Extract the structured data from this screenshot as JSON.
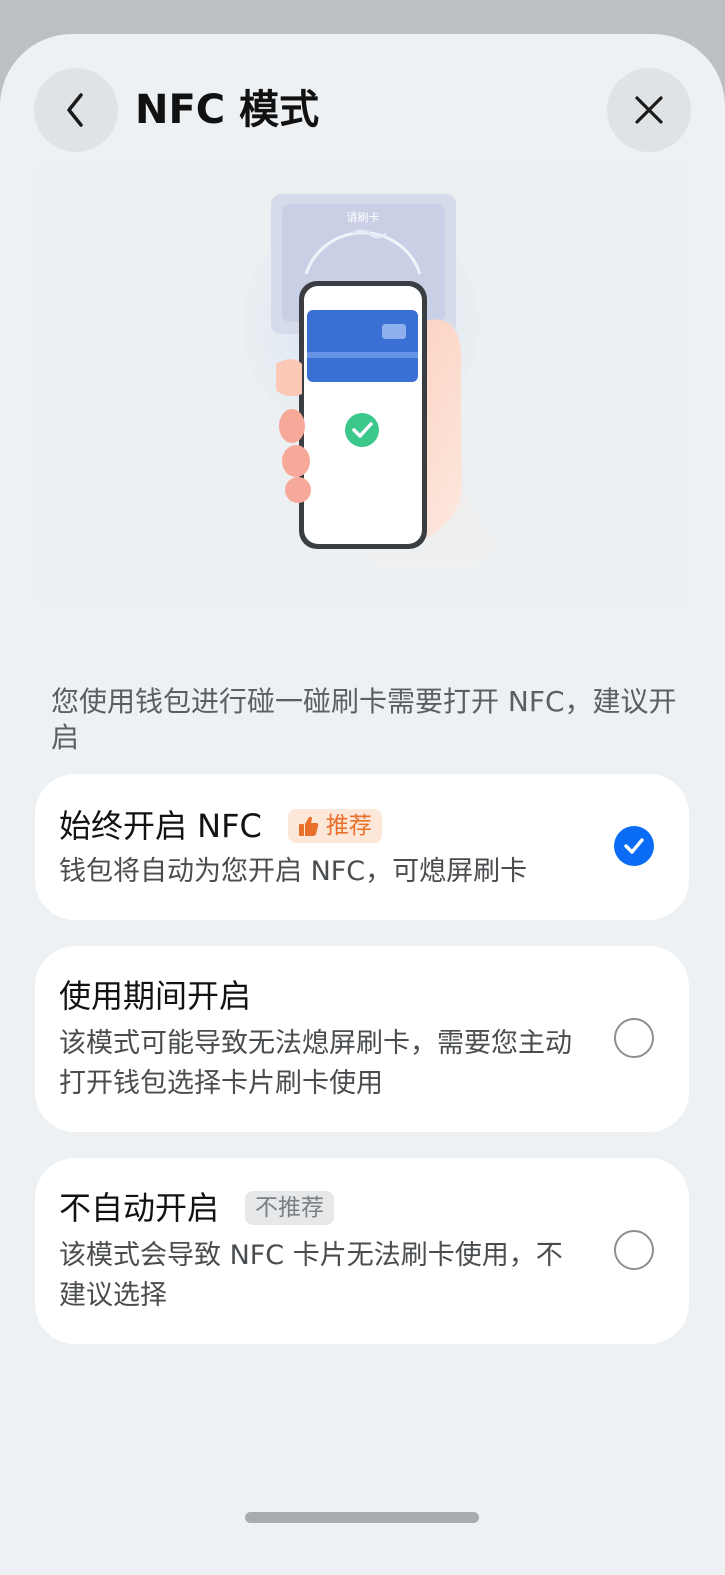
{
  "header": {
    "title": "NFC 模式",
    "back_icon": "chevron-left-icon",
    "close_icon": "close-icon"
  },
  "illustration": {
    "reader_label": "请刷卡",
    "card_color": "#3a6fd4",
    "check_color": "#3cc88a"
  },
  "description": "您使用钱包进行碰一碰刷卡需要打开 NFC，建议开启",
  "options": [
    {
      "title": "始终开启 NFC",
      "badge": "推荐",
      "badge_icon": "thumbs-up-icon",
      "subtitle": "钱包将自动为您开启 NFC，可熄屏刷卡",
      "selected": true
    },
    {
      "title": "使用期间开启",
      "badge": "",
      "subtitle": "该模式可能导致无法熄屏刷卡，需要您主动打开钱包选择卡片刷卡使用",
      "selected": false
    },
    {
      "title": "不自动开启",
      "badge": "不推荐",
      "subtitle": "该模式会导致 NFC 卡片无法刷卡使用，不建议选择",
      "selected": false
    }
  ],
  "colors": {
    "accent": "#0a6cf5",
    "recommend_badge_text": "#e8702a",
    "recommend_badge_bg": "#fde7d8"
  }
}
